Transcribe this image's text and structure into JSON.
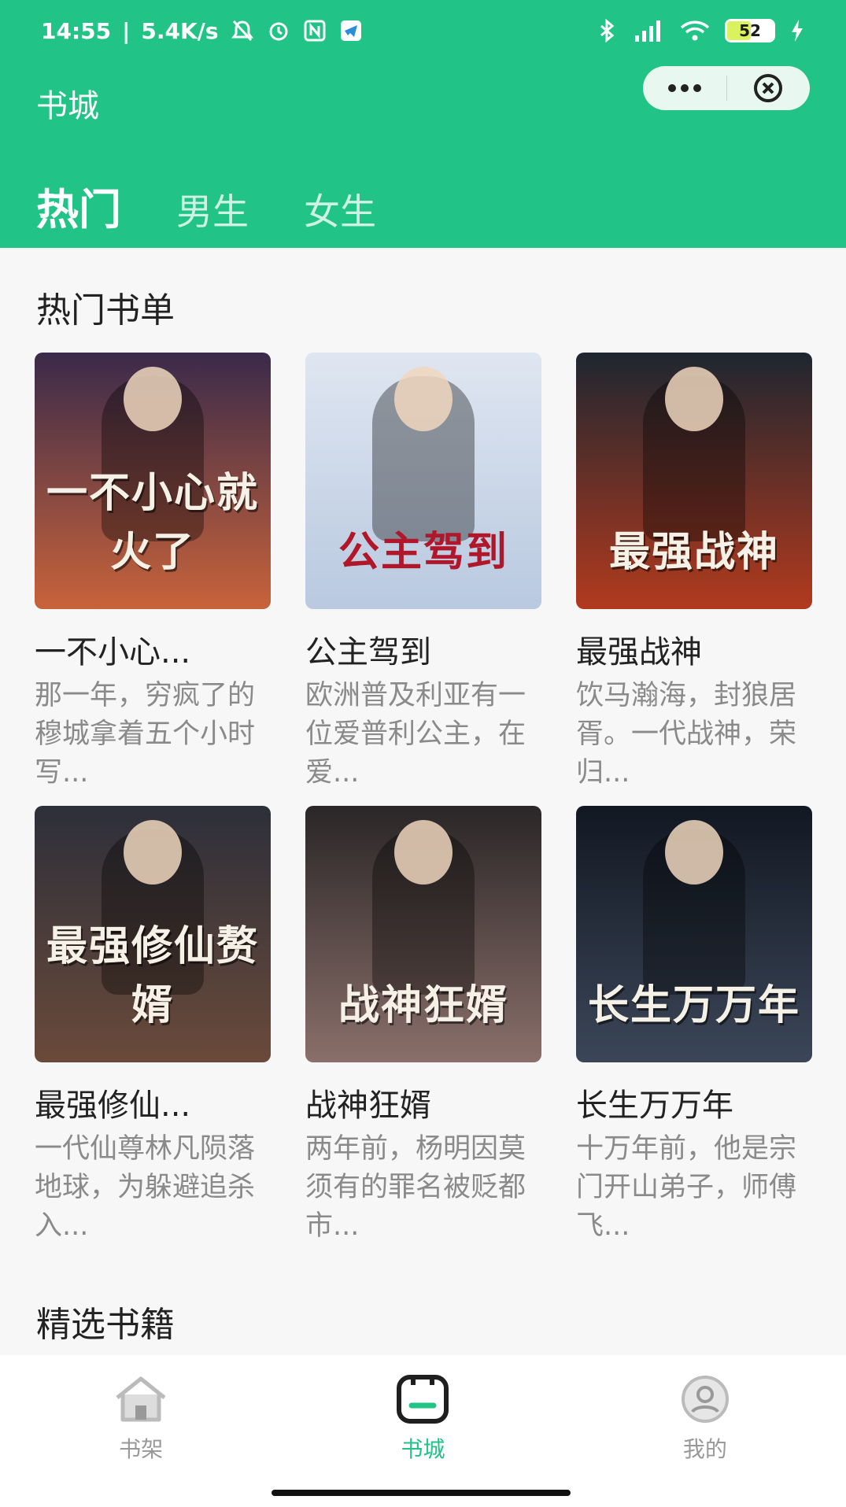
{
  "status_bar": {
    "time": "14:55",
    "speed": "5.4K/s",
    "battery": "52",
    "icons": [
      "mute-icon",
      "alarm-icon",
      "nfc-icon",
      "telegram-icon",
      "bluetooth-icon",
      "signal-icon",
      "wifi-icon",
      "battery-icon",
      "charging-icon"
    ]
  },
  "header": {
    "title": "书城",
    "tabs": [
      {
        "label": "热门",
        "active": true
      },
      {
        "label": "男生",
        "active": false
      },
      {
        "label": "女生",
        "active": false
      }
    ],
    "capsule": {
      "more_icon": "more-dots-icon",
      "close_icon": "close-circle-icon"
    }
  },
  "sections": {
    "hot_booklist": "热门书单",
    "selected_books": "精选书籍"
  },
  "books": [
    {
      "name": "一不小心...",
      "desc": "那一年，穷疯了的穆城拿着五个小时写...",
      "cover_text": "一不小心就火了",
      "cover_colors": [
        "#3a2a4a",
        "#c8633a"
      ]
    },
    {
      "name": "公主驾到",
      "desc": "欧洲普及利亚有一位爱普利公主，在爱...",
      "cover_text": "公主驾到",
      "cover_colors": [
        "#dfe6f1",
        "#b9c9e0"
      ]
    },
    {
      "name": "最强战神",
      "desc": "饮马瀚海，封狼居胥。一代战神，荣归...",
      "cover_text": "最强战神",
      "cover_colors": [
        "#1e2630",
        "#b23a1e"
      ]
    },
    {
      "name": "最强修仙...",
      "desc": "一代仙尊林凡陨落地球，为躲避追杀入...",
      "cover_text": "最强修仙赘婿",
      "cover_colors": [
        "#2d2f3a",
        "#6a4a3a"
      ]
    },
    {
      "name": "战神狂婿",
      "desc": "两年前，杨明因莫须有的罪名被贬都市...",
      "cover_text": "战神狂婿",
      "cover_colors": [
        "#2a2627",
        "#8a6f6a"
      ]
    },
    {
      "name": "长生万万年",
      "desc": "十万年前，他是宗门开山弟子，师傅飞...",
      "cover_text": "长生万万年",
      "cover_colors": [
        "#121822",
        "#3b4658"
      ]
    }
  ],
  "tabbar": [
    {
      "label": "书架",
      "icon": "home-icon",
      "active": false
    },
    {
      "label": "书城",
      "icon": "store-icon",
      "active": true
    },
    {
      "label": "我的",
      "icon": "profile-icon",
      "active": false
    }
  ],
  "colors": {
    "brand": "#22c386",
    "text": "#222222",
    "muted": "#8a8a8a"
  }
}
